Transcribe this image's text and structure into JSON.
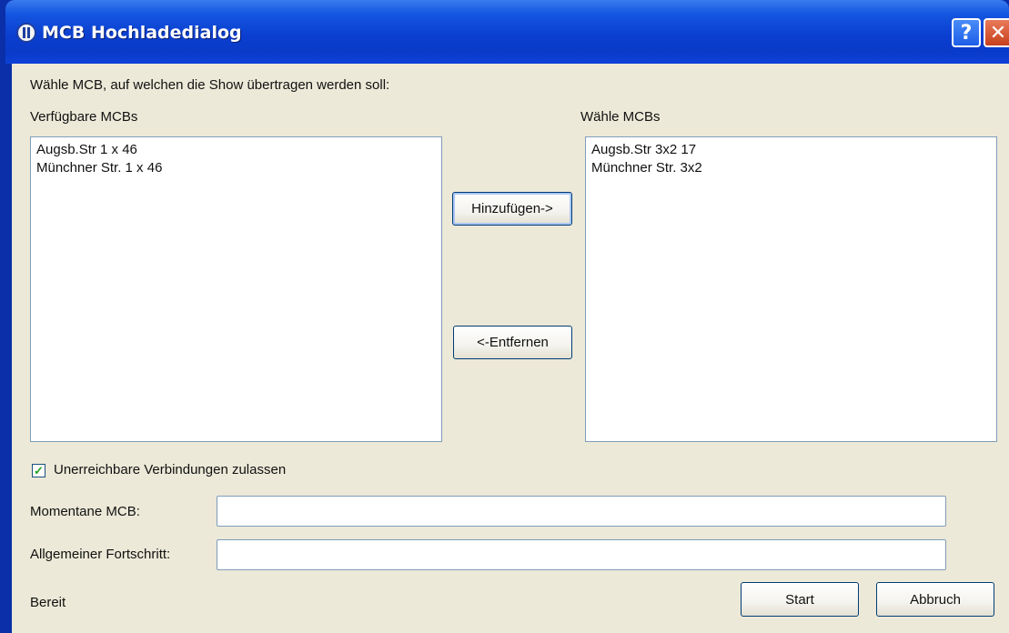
{
  "window": {
    "title": "MCB Hochladedialog",
    "help_glyph": "?",
    "close_glyph": "✕"
  },
  "instruction": "Wähle MCB, auf welchen die Show übertragen werden soll:",
  "available": {
    "label": "Verfügbare MCBs",
    "items": [
      "Augsb.Str  1 x 46",
      "Münchner Str. 1 x 46"
    ]
  },
  "selected": {
    "label": "Wähle MCBs",
    "items": [
      "Augsb.Str 3x2 17",
      "Münchner Str. 3x2"
    ]
  },
  "buttons": {
    "add": "Hinzufügen->",
    "remove": "<-Entfernen",
    "start": "Start",
    "cancel": "Abbruch"
  },
  "options": {
    "allow_unreachable_label": "Unerreichbare Verbindungen zulassen",
    "allow_unreachable_checked": true
  },
  "progress": {
    "current_label": "Momentane MCB:",
    "overall_label": "Allgemeiner Fortschritt:"
  },
  "status": "Bereit"
}
